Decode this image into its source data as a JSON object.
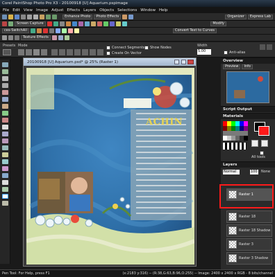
{
  "window_title": "Corel PaintShop Photo Pro X3 - 20100918 [U] Aquarium.pspimage",
  "menu": [
    "File",
    "Edit",
    "View",
    "Image",
    "Adjust",
    "Effects",
    "Layers",
    "Objects",
    "Selections",
    "Window",
    "Help"
  ],
  "toolbar1": {
    "enhance_photo": "Enhance Photo",
    "photo_effects": "Photo Effects",
    "organizer": "Organizer",
    "express_lab": "Express Lab"
  },
  "toolbar2": {
    "screen_capture": "Screen Capture",
    "modify": "Modify"
  },
  "toolbar3": {
    "switch_all": "ces-SwitchAll",
    "convert_text": "Convert Text to Curves"
  },
  "toolbar4": {
    "texture_effects": "Texture Effects"
  },
  "tool_options": {
    "preset_label": "Presets",
    "mode_label": "Mode",
    "connect_segments": "Connect Segments",
    "create_on_vector": "Create On Vector",
    "show_nodes": "Show Nodes",
    "width_label": "Width",
    "width_value": "5.00",
    "antialias": "Anti-alias"
  },
  "document": {
    "title": "20100918 [U] Aquarium.psd* @ 25% (Raster 1)",
    "heading": "ACHIN"
  },
  "panels": {
    "overview": "Overview",
    "overview_tabs": [
      "Preview",
      "Info"
    ],
    "script_output": "Script Output",
    "materials": "Materials",
    "all_tools": "All tools",
    "layers": "Layers",
    "blend_mode": "Normal",
    "opacity": "100",
    "none_label": "None"
  },
  "layers": [
    "Raster 1",
    "Raster 18",
    "Raster 18 Shadow",
    "Raster 3",
    "Raster 3 Shadow"
  ],
  "status": {
    "left": "Pen Tool: For Help, press F1",
    "right": "(x:2183 y:316) -- (R:38,G:63,B:96,O:255) -- Image: 2400 x 2400 x RGB - 8 bits/channel"
  },
  "colors": {
    "accent_red": "#e02020",
    "selection_highlight": "#ff1a1a",
    "fg_swatch": "#000000",
    "bg_swatch": "#ff0000"
  }
}
